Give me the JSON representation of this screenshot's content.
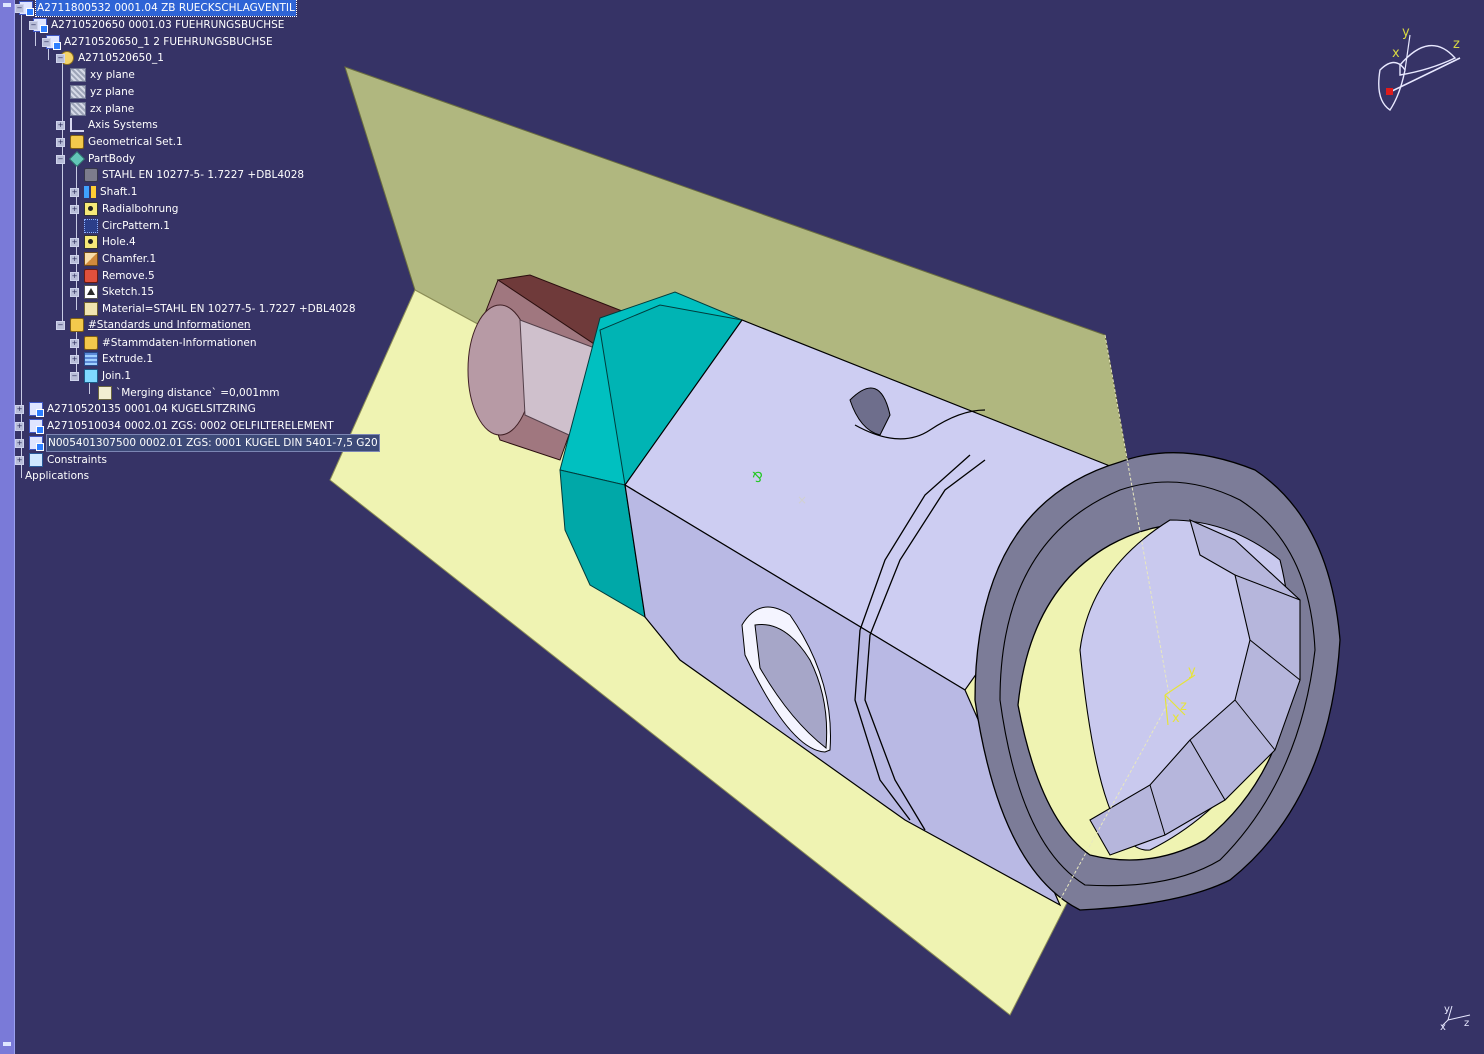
{
  "tree": {
    "items": [
      {
        "id": "root",
        "label": "A2711800532 0001.04  ZB RUECKSCHLAGVENTIL",
        "icon": "product-icon",
        "selected": true
      },
      {
        "id": "p1",
        "label": "A2710520650 0001.03  FUEHRUNGSBUCHSE",
        "icon": "product-icon"
      },
      {
        "id": "p1-inst",
        "label": "A2710520650_1 2  FUEHRUNGSBUCHSE",
        "icon": "product-icon"
      },
      {
        "id": "part",
        "label": "A2710520650_1",
        "icon": "part-icon"
      },
      {
        "id": "xy",
        "label": "xy plane",
        "icon": "plane-icon"
      },
      {
        "id": "yz",
        "label": "yz plane",
        "icon": "plane-icon"
      },
      {
        "id": "zx",
        "label": "zx plane",
        "icon": "plane-icon"
      },
      {
        "id": "axis",
        "label": "Axis Systems",
        "icon": "axis-system-icon"
      },
      {
        "id": "gset",
        "label": "Geometrical Set.1",
        "icon": "geometrical-set-icon"
      },
      {
        "id": "body",
        "label": "PartBody",
        "icon": "partbody-icon"
      },
      {
        "id": "stahl",
        "label": "STAHL EN 10277-5- 1.7227   +DBL4028",
        "icon": "material-icon"
      },
      {
        "id": "shaft",
        "label": "Shaft.1",
        "icon": "shaft-icon"
      },
      {
        "id": "radial",
        "label": "Radialbohrung",
        "icon": "hole-icon"
      },
      {
        "id": "circ",
        "label": "CircPattern.1",
        "icon": "pattern-icon"
      },
      {
        "id": "hole4",
        "label": "Hole.4",
        "icon": "hole-icon"
      },
      {
        "id": "chamfer",
        "label": "Chamfer.1",
        "icon": "chamfer-icon"
      },
      {
        "id": "remove",
        "label": "Remove.5",
        "icon": "remove-icon"
      },
      {
        "id": "sketch",
        "label": "Sketch.15",
        "icon": "sketch-icon"
      },
      {
        "id": "matparam",
        "label": "Material=STAHL EN 10277-5- 1.7227   +DBL4028",
        "icon": "material-parameter-icon"
      },
      {
        "id": "standards",
        "label": "#Standards und Informationen",
        "icon": "geometrical-set-icon",
        "underline": true
      },
      {
        "id": "stamm",
        "label": "#Stammdaten-Informationen",
        "icon": "geometrical-set-icon"
      },
      {
        "id": "extrude",
        "label": "Extrude.1",
        "icon": "extrude-icon"
      },
      {
        "id": "join",
        "label": "Join.1",
        "icon": "join-icon"
      },
      {
        "id": "merge",
        "label": "`Merging distance` =0,001mm",
        "icon": "parameter-icon"
      },
      {
        "id": "p2",
        "label": "A2710520135 0001.04  KUGELSITZRING",
        "icon": "product-icon"
      },
      {
        "id": "p3",
        "label": "A2710510034 0002.01 ZGS: 0002  OELFILTERELEMENT",
        "icon": "product-icon"
      },
      {
        "id": "p4",
        "label": "N005401307500 0002.01 ZGS: 0001  KUGEL DIN 5401-7,5   G20",
        "icon": "product-icon",
        "boxed": true
      },
      {
        "id": "constraints",
        "label": "Constraints",
        "icon": "constraints-icon"
      },
      {
        "id": "apps",
        "label": "Applications",
        "icon": ""
      }
    ]
  },
  "compass": {
    "x_label": "x",
    "y_label": "y",
    "z_label": "z"
  },
  "part_axis": {
    "x_label": "x",
    "y_label": "y",
    "z_label": "z"
  },
  "corner_axis": {
    "x_label": "x",
    "y_label": "y",
    "z_label": "z"
  },
  "colors": {
    "background": "#363366",
    "plane_upper": "#b0b77f",
    "plane_lower": "#eff3b2",
    "body": "#c8c8ee",
    "body_dark": "#7f7f9a",
    "ring_accent": "#00c0c0",
    "brown_cylinder": "#6f3a3a",
    "tree_selected": "#2f64d6"
  }
}
